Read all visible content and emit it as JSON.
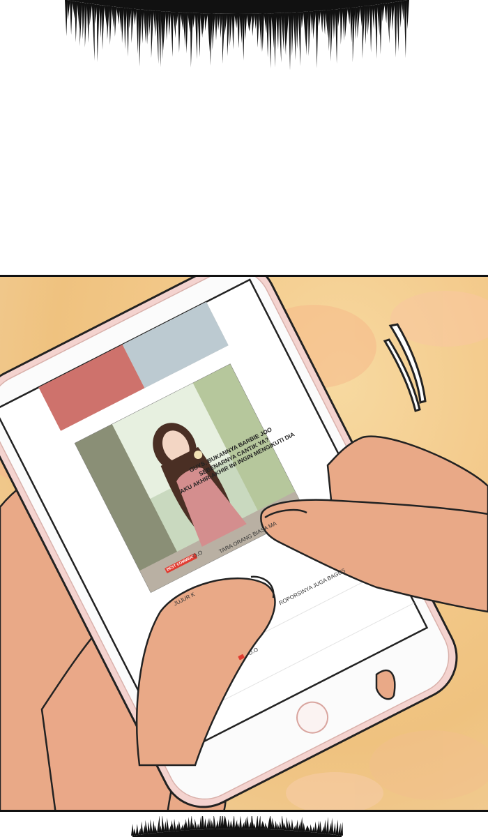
{
  "post": {
    "caption_lines": [
      "GUYS, BUKANNYA BARBIE JOO",
      "SEBENARNYA CANTIK YA?",
      "AKU AKHIR-AKHIR INI INGIN MENGIKUTI DIA"
    ]
  },
  "comments": [
    {
      "badge": "BEST COMMENT",
      "username": "O.O",
      "text_left": "JUJUR K",
      "text_mid": "TARA ORANG BIASA MA",
      "text_right": "ROPORSINYA JUGA BAGUS"
    },
    {
      "username": "O.O"
    }
  ],
  "colors": {
    "background": "#efc27f",
    "phone_body": "#f4d3cf",
    "skin": "#e9a987",
    "badge": "#e03c31"
  }
}
